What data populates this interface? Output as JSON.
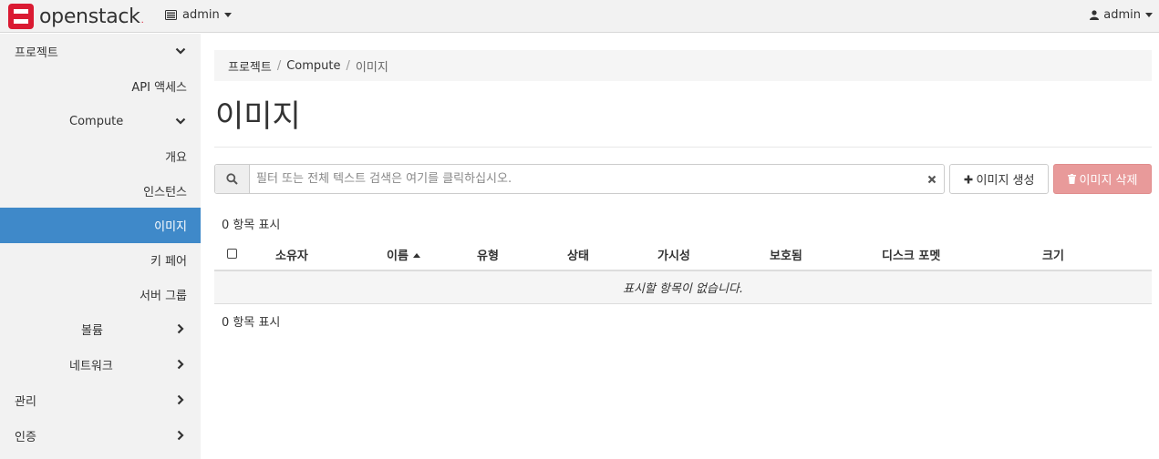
{
  "header": {
    "brand": "openstack",
    "project": "admin",
    "user": "admin"
  },
  "sidebar": {
    "items": [
      {
        "label": "프로젝트",
        "indent": 0,
        "expanded": true
      },
      {
        "label": "API 액세스",
        "indent": 1
      },
      {
        "label": "Compute",
        "indent": 1,
        "expanded": true
      },
      {
        "label": "개요",
        "indent": 2
      },
      {
        "label": "인스턴스",
        "indent": 2
      },
      {
        "label": "이미지",
        "indent": 2,
        "active": true
      },
      {
        "label": "키 페어",
        "indent": 2
      },
      {
        "label": "서버 그룹",
        "indent": 2
      },
      {
        "label": "볼륨",
        "indent": 1,
        "expanded": false
      },
      {
        "label": "네트워크",
        "indent": 1,
        "expanded": false
      },
      {
        "label": "관리",
        "indent": 0,
        "expanded": false
      },
      {
        "label": "인증",
        "indent": 0,
        "expanded": false
      }
    ]
  },
  "breadcrumb": [
    "프로젝트",
    "Compute",
    "이미지"
  ],
  "page_title": "이미지",
  "search": {
    "placeholder": "필터 또는 전체 텍스트 검색은 여기를 클릭하십시오.",
    "value": ""
  },
  "actions": {
    "create_label": "이미지 생성",
    "delete_label": "이미지 삭제"
  },
  "table": {
    "count_label": "0 항목 표시",
    "columns": [
      "소유자",
      "이름",
      "유형",
      "상태",
      "가시성",
      "보호됨",
      "디스크 포멧",
      "크기"
    ],
    "empty_message": "표시할 항목이 없습니다."
  },
  "colors": {
    "active_nav": "#3f89c9",
    "delete_button": "#e89a9a",
    "brand_red": "#da1a32"
  }
}
